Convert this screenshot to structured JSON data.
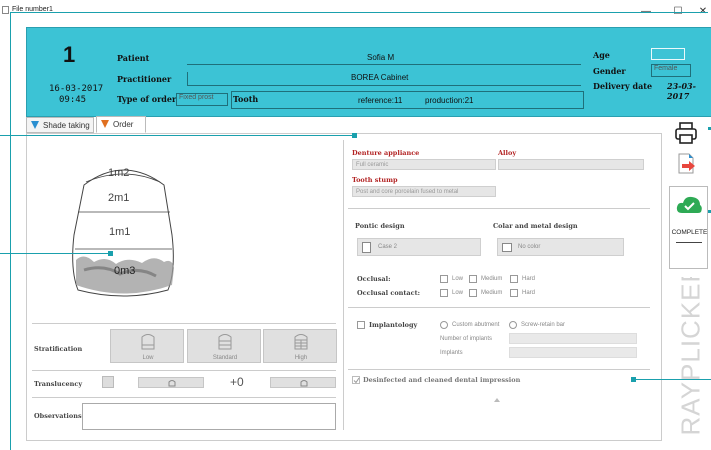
{
  "window": {
    "title": "File number1",
    "minimize": "—",
    "maximize": "☐",
    "close": "✕"
  },
  "header": {
    "case_number": "1",
    "date": "16-03-2017",
    "time": "09:45",
    "patient_label": "Patient",
    "patient_value": "Sofia M",
    "practitioner_label": "Practitioner",
    "practitioner_value": "BOREA Cabinet",
    "type_of_order_label": "Type of order",
    "type_of_order_value": "Fixed prost",
    "tooth_label": "Tooth",
    "tooth_reference": "reference:11",
    "tooth_production": "production:21",
    "age_label": "Age",
    "gender_label": "Gender",
    "gender_value": "Female",
    "delivery_label": "Delivery date",
    "delivery_value": "23-03-2017"
  },
  "tabs": [
    {
      "label": "Shade taking",
      "color": "#2a8fd0"
    },
    {
      "label": "Order",
      "color": "#e07020"
    }
  ],
  "tooth_diagram": {
    "zones": [
      "1m2",
      "2m1",
      "1m1",
      "0m3"
    ]
  },
  "stratification": {
    "label": "Stratification",
    "options": [
      "Low",
      "Standard",
      "High"
    ]
  },
  "translucency": {
    "label": "Translucency",
    "value": "+0"
  },
  "observations": {
    "label": "Observations"
  },
  "order": {
    "denture_appliance_label": "Denture appliance",
    "denture_appliance_value": "Full ceramic",
    "alloy_label": "Alloy",
    "tooth_stump_label": "Tooth stump",
    "tooth_stump_value": "Post and core porcelain fused to metal",
    "pontic_design_label": "Pontic design",
    "pontic_design_value": "Case 2",
    "collar_label": "Colar and metal design",
    "collar_value": "No color",
    "occlusal_label": "Occlusal:",
    "occlusal_contact_label": "Occlusal contact:",
    "checkbox_options": [
      "Low",
      "Medium",
      "Hard"
    ],
    "implantology_label": "Implantology",
    "custom_abutment": "Custom abutment",
    "screw_retain_bar": "Screw-retain bar",
    "number_of_implants": "Number of implants",
    "implants": "Implants",
    "desinfected_label": "Desinfected and cleaned dental impression"
  },
  "sidebar": {
    "complete_label": "COMPLETE",
    "brand": "RAYPLICKER"
  },
  "colors": {
    "header_bg": "#3cc3d5",
    "accent": "#1aa0ad",
    "red": "#b22222",
    "green": "#2eaa55"
  },
  "icons": [
    "printer-icon",
    "export-icon",
    "cloud-complete-icon"
  ]
}
